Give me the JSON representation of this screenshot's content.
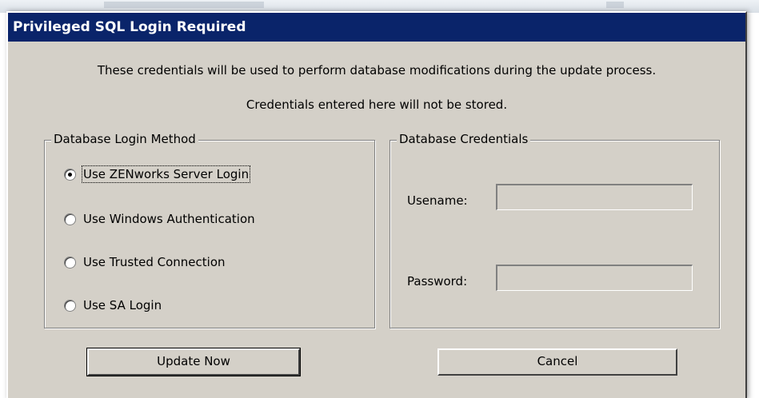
{
  "dialog": {
    "title": "Privileged SQL Login Required",
    "description_line1": "These credentials will be used to perform database modifications during the update process.",
    "description_line2": "Credentials entered here will not be stored."
  },
  "login_method": {
    "legend": "Database Login Method",
    "options": [
      {
        "label": "Use ZENworks Server Login",
        "checked": true
      },
      {
        "label": "Use Windows Authentication",
        "checked": false
      },
      {
        "label": "Use Trusted Connection",
        "checked": false
      },
      {
        "label": "Use SA Login",
        "checked": false
      }
    ]
  },
  "credentials": {
    "legend": "Database Credentials",
    "username_label": "Usename:",
    "username_value": "",
    "password_label": "Password:",
    "password_value": ""
  },
  "buttons": {
    "update_label": "Update Now",
    "cancel_label": "Cancel"
  },
  "colors": {
    "titlebar": "#0a246a",
    "dialog_face": "#d4d0c8"
  }
}
